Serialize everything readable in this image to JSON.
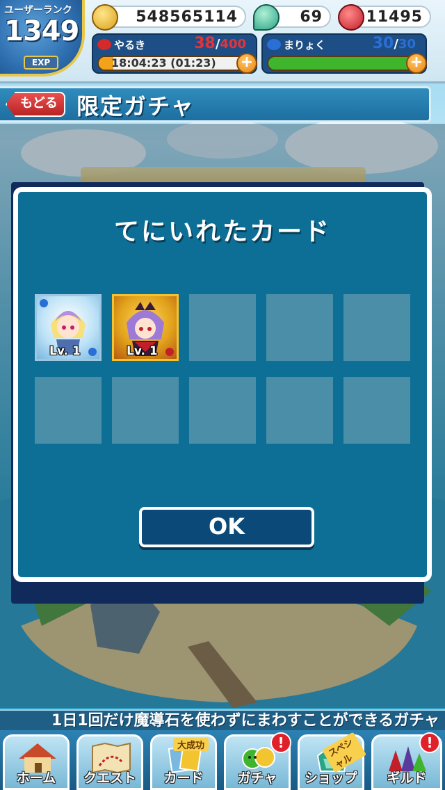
{
  "header": {
    "rank_label": "ユーザーランク",
    "rank_value": "1349",
    "exp_label": "EXP",
    "coins": "548565114",
    "gems": "69",
    "tickets": "11495",
    "stamina": {
      "label": "やるき",
      "current": "38",
      "separator": "/",
      "max": "400",
      "timer": "18:04:23 (01:23)",
      "fill_fraction": 0.095
    },
    "magic": {
      "label": "まりょく",
      "current": "30",
      "separator": "/",
      "max": "30",
      "fill_fraction": 1.0
    },
    "plus_symbol": "+"
  },
  "title_bar": {
    "back_label": "もどる",
    "title": "限定ガチャ"
  },
  "modal": {
    "title": "てにいれたカード",
    "cards": [
      {
        "level": "Lv. 1",
        "rarity_color": "#bfe3f7",
        "frame_color": "#9fc6e0"
      },
      {
        "level": "Lv. 1",
        "rarity_color": "#e2a21c",
        "frame_color": "#f2c530"
      }
    ],
    "ok_label": "OK"
  },
  "marquee": "1日1回だけ魔導石を使わずにまわすことができるガチャ",
  "nav": {
    "items": [
      {
        "label": "ホーム",
        "icon": "house-icon"
      },
      {
        "label": "クエスト",
        "icon": "map-icon"
      },
      {
        "label": "カード",
        "icon": "card-icon",
        "ribbon": "大成功"
      },
      {
        "label": "ガチャ",
        "icon": "gacha-icon",
        "alert": "!"
      },
      {
        "label": "ショップ",
        "icon": "shop-icon",
        "ribbon": "スペシャル"
      },
      {
        "label": "ギルド",
        "icon": "guild-icon",
        "alert": "!"
      }
    ]
  },
  "colors": {
    "modal_bg": "#0e6f96",
    "slot_empty": "#4b8ea8",
    "stamina_fill": "#f2a21b",
    "magic_fill": "#3fb52e",
    "stamina_count": "#e8323a",
    "magic_count": "#2a6fd6"
  }
}
